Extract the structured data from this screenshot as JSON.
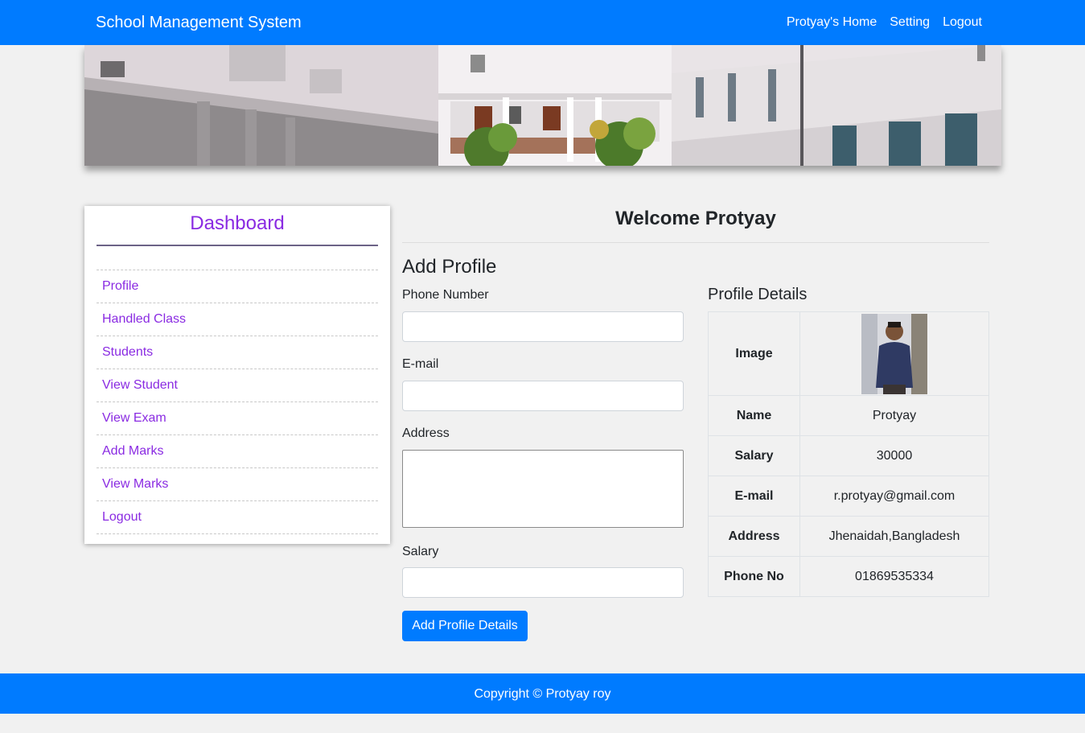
{
  "navbar": {
    "brand": "School Management System",
    "links": [
      "Protyay's Home",
      "Setting",
      "Logout"
    ]
  },
  "sidebar": {
    "title": "Dashboard",
    "items": [
      "Profile",
      "Handled Class",
      "Students",
      "View Student",
      "View Exam",
      "Add Marks",
      "View Marks",
      "Logout"
    ]
  },
  "main": {
    "welcome": "Welcome Protyay",
    "form": {
      "title": "Add Profile",
      "phone_label": "Phone Number",
      "phone_value": "",
      "email_label": "E-mail",
      "email_value": "",
      "address_label": "Address",
      "address_value": "",
      "salary_label": "Salary",
      "salary_value": "",
      "submit_label": "Add Profile Details"
    },
    "details": {
      "title": "Profile Details",
      "image_label": "Image",
      "rows": [
        {
          "key": "Name",
          "value": "Protyay"
        },
        {
          "key": "Salary",
          "value": "30000"
        },
        {
          "key": "E-mail",
          "value": "r.protyay@gmail.com"
        },
        {
          "key": "Address",
          "value": "Jhenaidah,Bangladesh"
        },
        {
          "key": "Phone No",
          "value": "01869535334"
        }
      ]
    }
  },
  "footer": {
    "copyright": "Copyright © Protyay roy"
  },
  "colors": {
    "primary": "#007bff",
    "accent": "#8a2be2",
    "background": "#f1f1f1"
  }
}
